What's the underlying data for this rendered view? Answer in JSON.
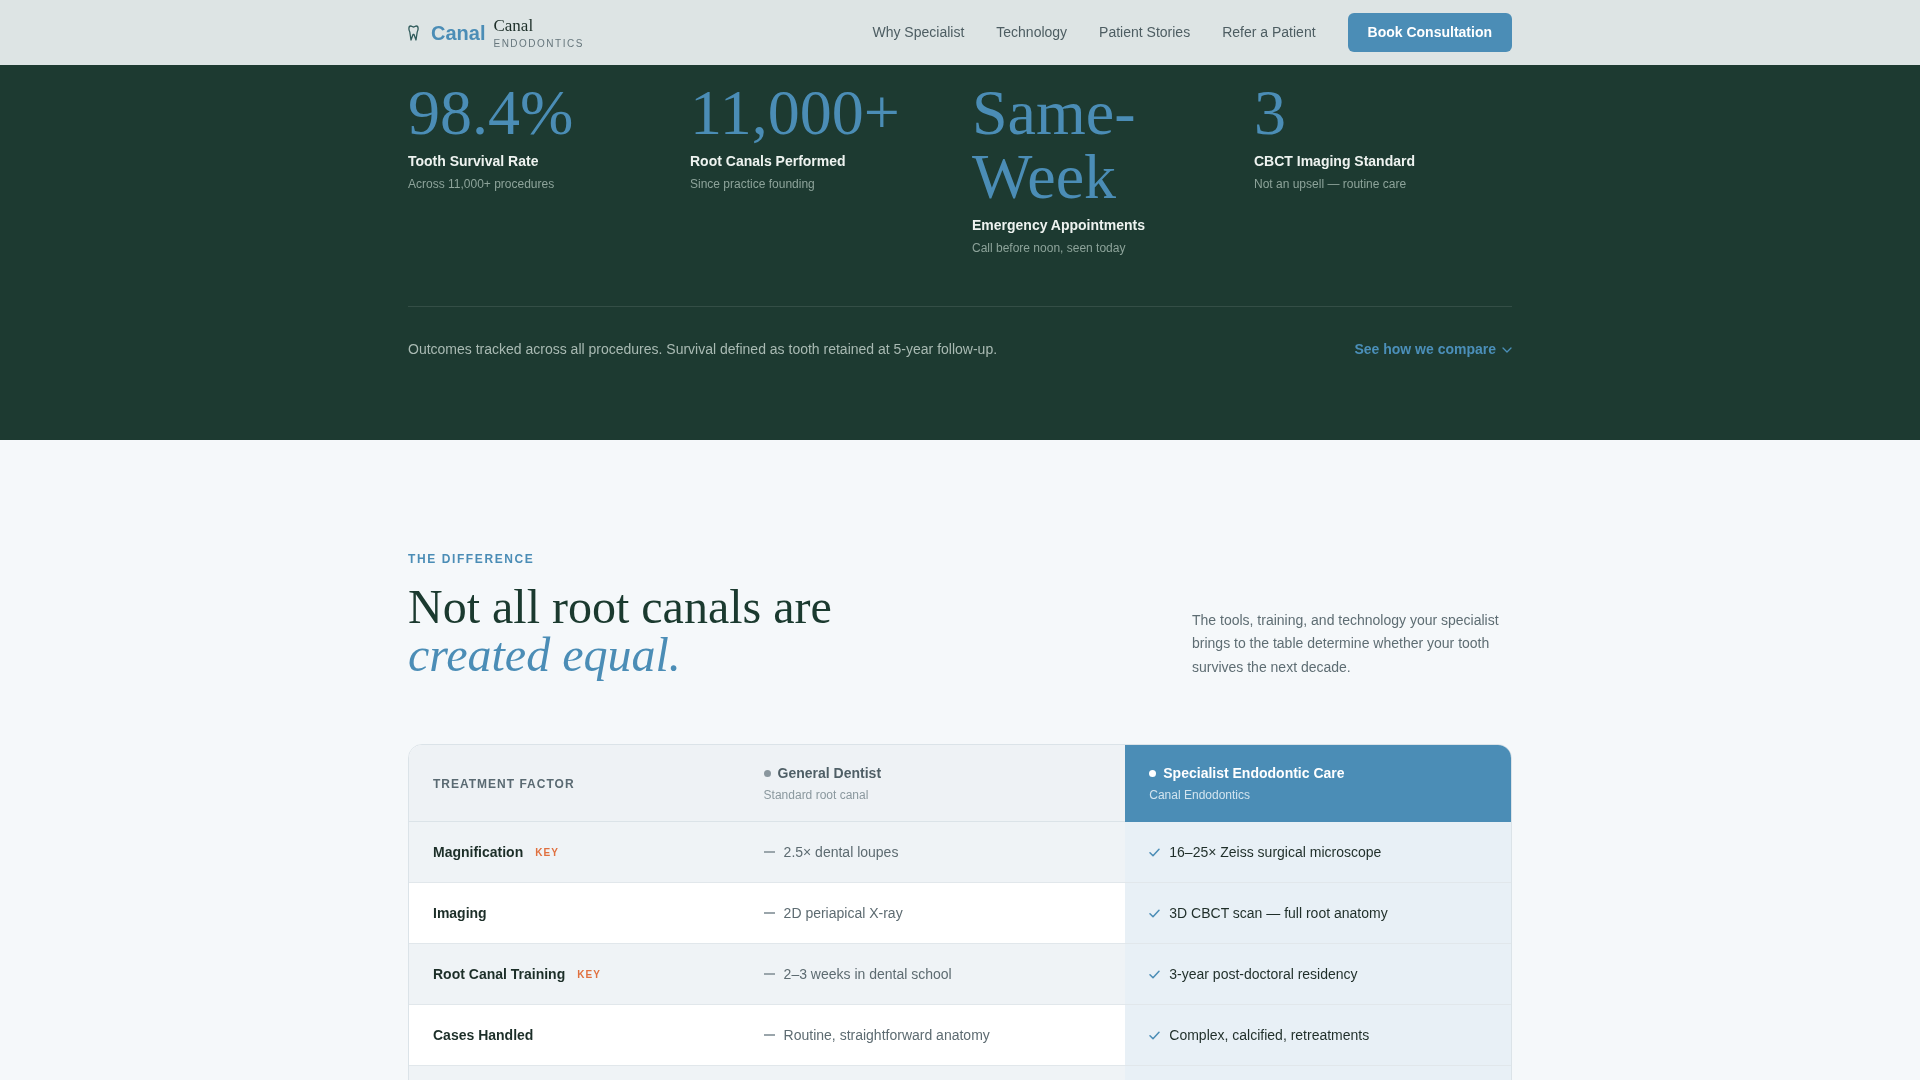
{
  "nav": {
    "logo": {
      "wordmark": "Canal",
      "name": "Canal",
      "tagline": "ENDODONTICS"
    },
    "links": [
      "Why Specialist",
      "Technology",
      "Patient Stories",
      "Refer a Patient"
    ],
    "cta": "Book Consultation"
  },
  "stats": {
    "items": [
      {
        "value": "98.4%",
        "label": "Tooth Survival Rate",
        "note": "Across 11,000+ procedures"
      },
      {
        "value": "11,000+",
        "label": "Root Canals Performed",
        "note": "Since practice founding"
      },
      {
        "value": "Same-Week",
        "label": "Emergency Appointments",
        "note": "Call before noon, seen today"
      },
      {
        "value": "3",
        "label": "CBCT Imaging Standard",
        "note": "Not an upsell — routine care"
      }
    ],
    "footnote": "Outcomes tracked across all procedures. Survival defined as tooth retained at 5-year follow-up.",
    "compare_link": "See how we compare"
  },
  "difference": {
    "eyebrow": "THE DIFFERENCE",
    "heading": "Not all root canals are",
    "heading_emphasis": "created equal.",
    "intro": "The tools, training, and technology your specialist brings to the table determine whether your tooth survives the next decade."
  },
  "table": {
    "columns": [
      {
        "kind": "label",
        "title": "TREATMENT FACTOR",
        "highlighted": false
      },
      {
        "kind": "option",
        "title": "General Dentist",
        "subtitle": "Standard root canal",
        "highlighted": false
      },
      {
        "kind": "option",
        "title": "Specialist Endodontic Care",
        "subtitle": "Canal Endodontics",
        "highlighted": true
      }
    ],
    "rows": [
      {
        "cells": [
          "Magnification",
          "2.5× dental loupes",
          "16–25× Zeiss surgical microscope"
        ],
        "badge": "KEY"
      },
      {
        "cells": [
          "Imaging",
          "2D periapical X-ray",
          "3D CBCT scan — full root anatomy"
        ]
      },
      {
        "cells": [
          "Root Canal Training",
          "2–3 weeks in dental school",
          "3-year post-doctoral residency"
        ],
        "badge": "KEY"
      },
      {
        "cells": [
          "Cases Handled",
          "Routine, straightforward anatomy",
          "Complex, calcified, retreatments"
        ]
      }
    ]
  }
}
